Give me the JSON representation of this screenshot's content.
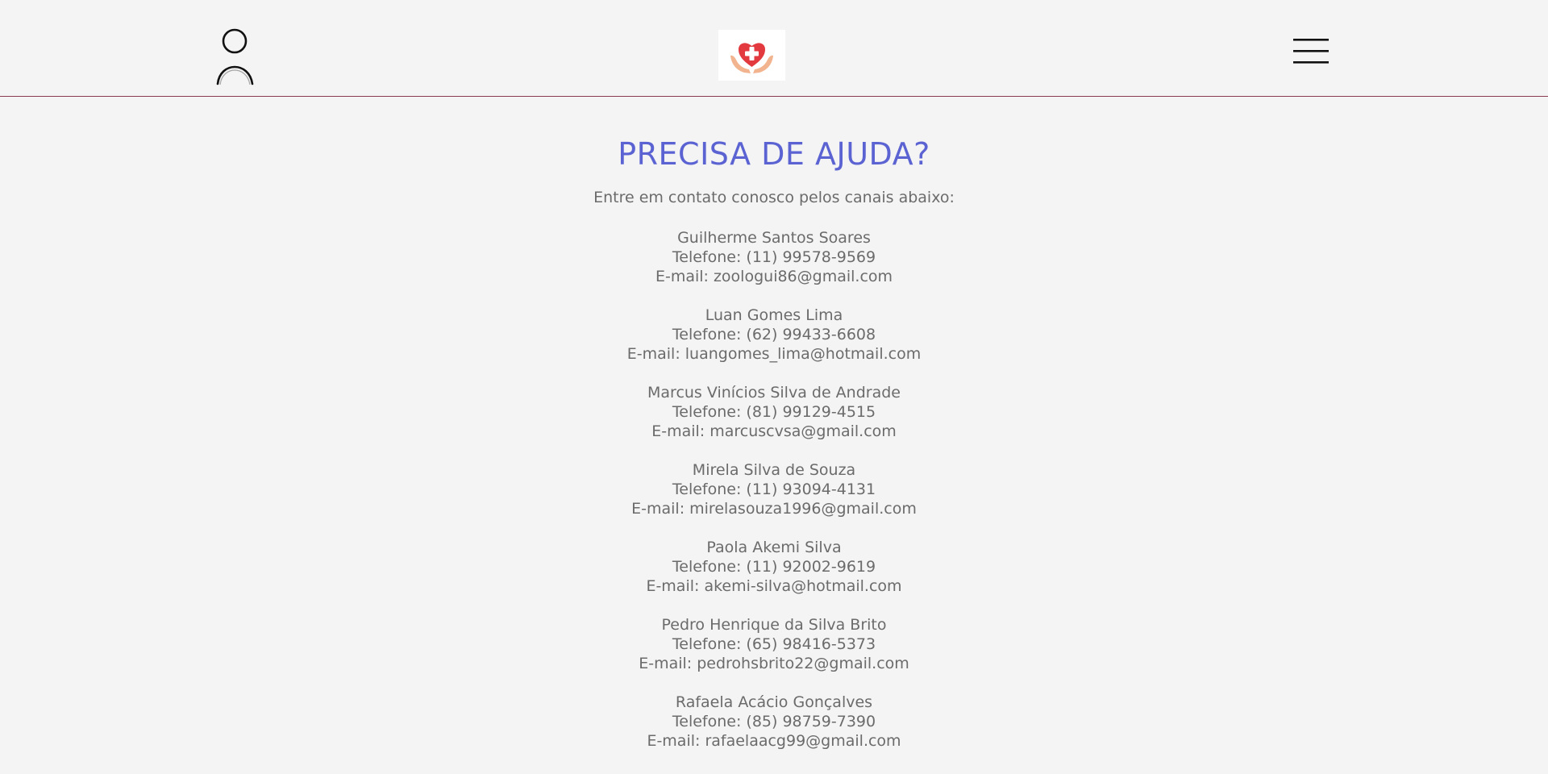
{
  "header": {
    "user_icon": "user-icon",
    "logo_icon": "heart-cross-hands-logo",
    "menu_icon": "hamburger-menu-icon"
  },
  "main": {
    "title": "PRECISA DE AJUDA?",
    "intro": "Entre em contato conosco pelos canais abaixo:",
    "contacts": [
      {
        "name": "Guilherme Santos Soares",
        "phone": "Telefone: (11) 99578-9569",
        "email": "E-mail: zoologui86@gmail.com"
      },
      {
        "name": "Luan Gomes Lima",
        "phone": "Telefone: (62) 99433-6608",
        "email": "E-mail: luangomes_lima@hotmail.com"
      },
      {
        "name": "Marcus Vinícios Silva de Andrade",
        "phone": "Telefone: (81) 99129-4515",
        "email": "E-mail: marcuscvsa@gmail.com"
      },
      {
        "name": "Mirela Silva de Souza",
        "phone": "Telefone: (11) 93094-4131",
        "email": "E-mail: mirelasouza1996@gmail.com"
      },
      {
        "name": "Paola Akemi Silva",
        "phone": "Telefone: (11) 92002-9619",
        "email": "E-mail: akemi-silva@hotmail.com"
      },
      {
        "name": "Pedro Henrique da Silva Brito",
        "phone": "Telefone: (65) 98416-5373",
        "email": "E-mail: pedrohsbrito22@gmail.com"
      },
      {
        "name": "Rafaela Acácio Gonçalves",
        "phone": "Telefone: (85) 98759-7390",
        "email": "E-mail: rafaelaacg99@gmail.com"
      }
    ]
  },
  "colors": {
    "title": "#5b63d3",
    "text": "#6b6b6b",
    "divider": "#8a3a52",
    "background": "#f4f4f4",
    "logo_heart": "#e23a3f",
    "logo_hands": "#f2b48f"
  }
}
